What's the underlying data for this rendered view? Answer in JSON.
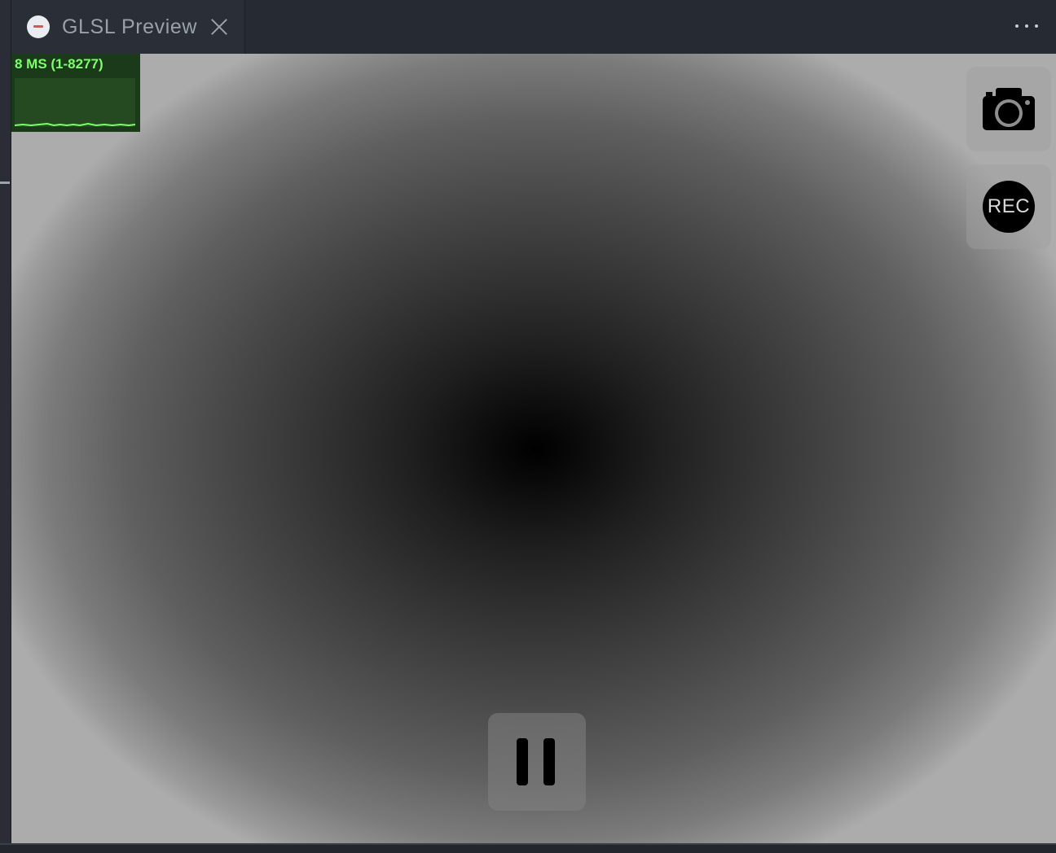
{
  "tab": {
    "title": "GLSL Preview",
    "icon": "shader-logo-icon",
    "close_icon": "close-icon"
  },
  "toolbar": {
    "more_icon": "more-options-icon"
  },
  "stats": {
    "label": "8 MS (1-8277)",
    "color": "#7cff6b",
    "background": "#1a3a1a"
  },
  "controls": {
    "camera_icon": "camera-icon",
    "record_label": "REC",
    "pause_icon": "pause-icon"
  }
}
